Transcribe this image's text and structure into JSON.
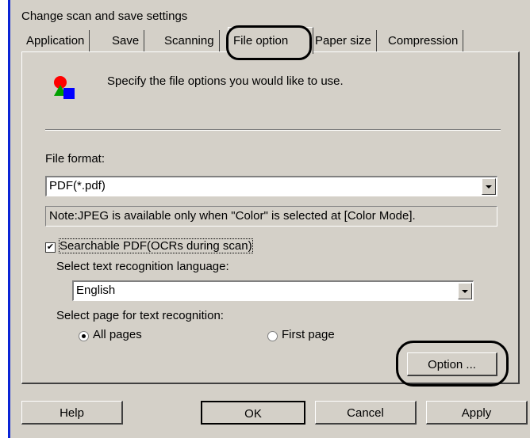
{
  "window": {
    "title": "Change scan and save settings"
  },
  "tabs": [
    "Application",
    "Save",
    "Scanning",
    "File option",
    "Paper size",
    "Compression"
  ],
  "active_tab": "File option",
  "header": {
    "description": "Specify the file options you would like to use."
  },
  "file_format": {
    "label": "File format:",
    "value": "PDF(*.pdf)",
    "note": "Note:JPEG is available only when \"Color\" is selected at [Color Mode]."
  },
  "searchable_pdf": {
    "label": "Searchable PDF(OCRs during scan)",
    "checked": true,
    "check_glyph": "✔"
  },
  "language": {
    "label": "Select text recognition language:",
    "value": "English"
  },
  "page_selection": {
    "label": "Select page for text recognition:",
    "options": [
      "All pages",
      "First page"
    ],
    "selected": "All pages"
  },
  "buttons": {
    "option": "Option ...",
    "help": "Help",
    "ok": "OK",
    "cancel": "Cancel",
    "apply": "Apply"
  },
  "colors": {
    "accent_border": "#0a24d6",
    "dialog_bg": "#d4d0c8"
  }
}
